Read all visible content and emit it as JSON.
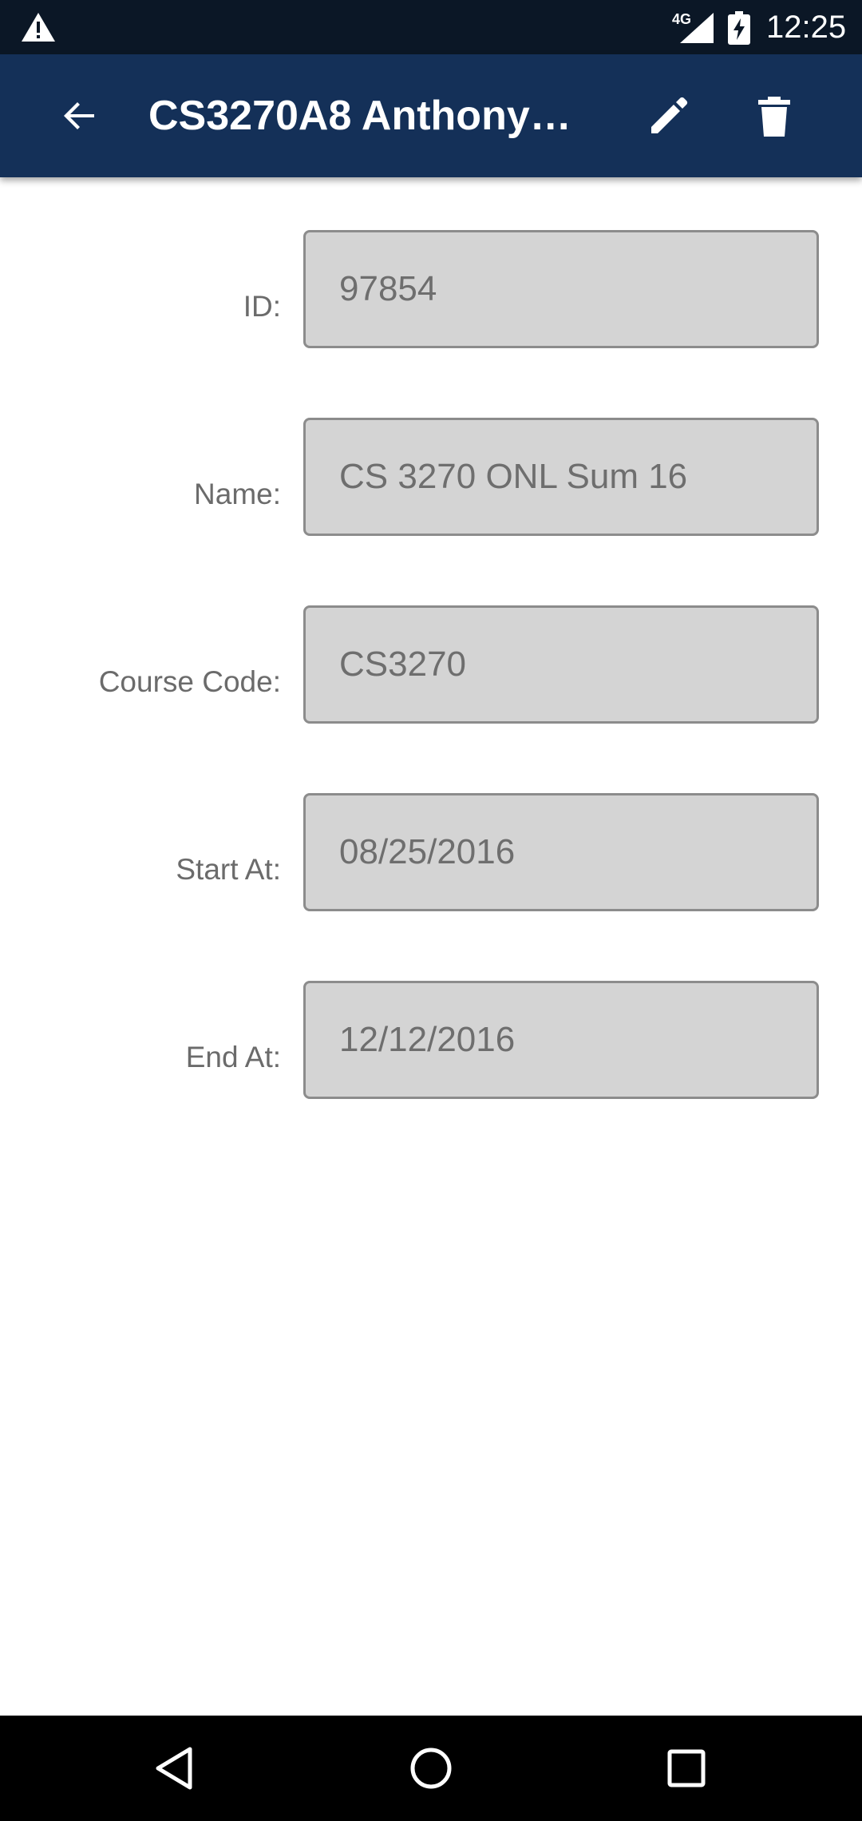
{
  "status_bar": {
    "network": "4G",
    "time": "12:25",
    "icons": [
      "warning-icon",
      "signal-icon",
      "battery-charging-icon"
    ]
  },
  "app_bar": {
    "title": "CS3270A8 Anthony…",
    "back_icon": "arrow-back-icon",
    "edit_icon": "pencil-icon",
    "delete_icon": "trash-icon",
    "color": "#143058"
  },
  "form": {
    "fields": [
      {
        "label": "ID:",
        "value": "97854"
      },
      {
        "label": "Name:",
        "value": "CS 3270 ONL Sum 16"
      },
      {
        "label": "Course Code:",
        "value": "CS3270"
      },
      {
        "label": "Start At:",
        "value": "08/25/2016"
      },
      {
        "label": "End At:",
        "value": "12/12/2016"
      }
    ]
  },
  "nav_bar": {
    "icons": [
      "nav-back-icon",
      "home-icon",
      "recents-icon"
    ]
  }
}
